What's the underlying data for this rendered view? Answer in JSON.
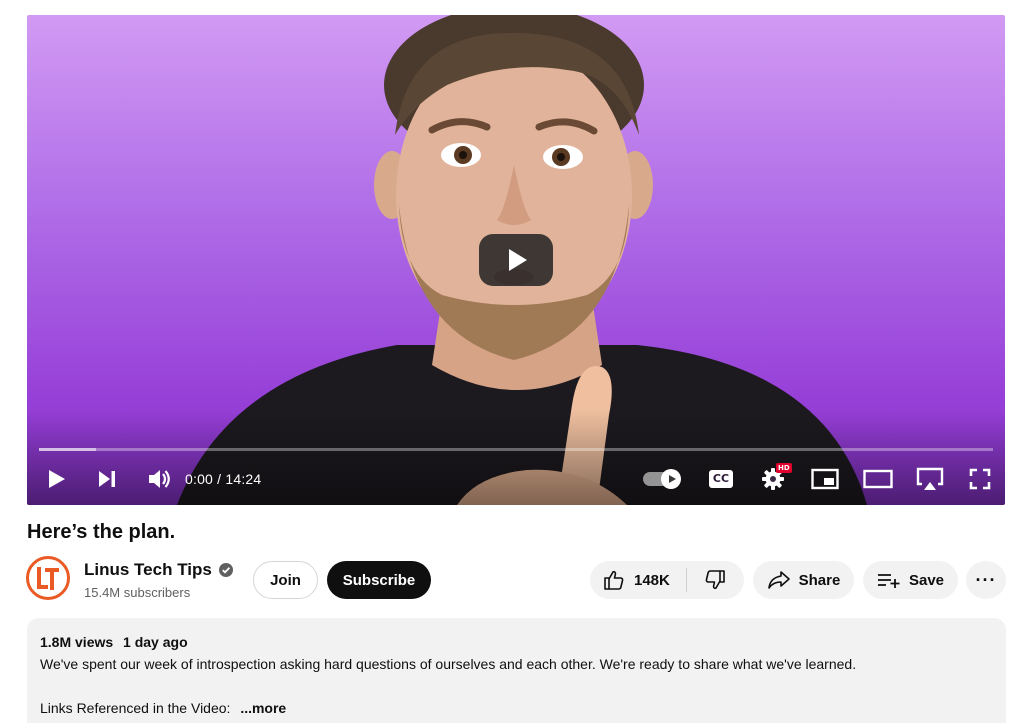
{
  "player": {
    "current_time": "0:00",
    "duration": "14:24",
    "time_separator": " / ",
    "buffered_fraction": 0.06,
    "played_fraction": 0,
    "autoplay_on": true,
    "quality_badge": "HD",
    "cc_label": "CC",
    "background_color": "#b16fe8"
  },
  "video": {
    "title": "Here’s the plan."
  },
  "channel": {
    "name": "Linus Tech Tips",
    "subscribers": "15.4M subscribers",
    "verified": true,
    "brand_color": "#e95a24"
  },
  "actions": {
    "join_label": "Join",
    "subscribe_label": "Subscribe",
    "like_count": "148K",
    "share_label": "Share",
    "save_label": "Save",
    "more_label": "···"
  },
  "description": {
    "views": "1.8M views",
    "age": "1 day ago",
    "text": "We've spent our week of introspection asking hard questions of ourselves and each other. We're ready to share what we've learned.",
    "links_label": "Links Referenced in the Video:",
    "more_label": "...more"
  }
}
